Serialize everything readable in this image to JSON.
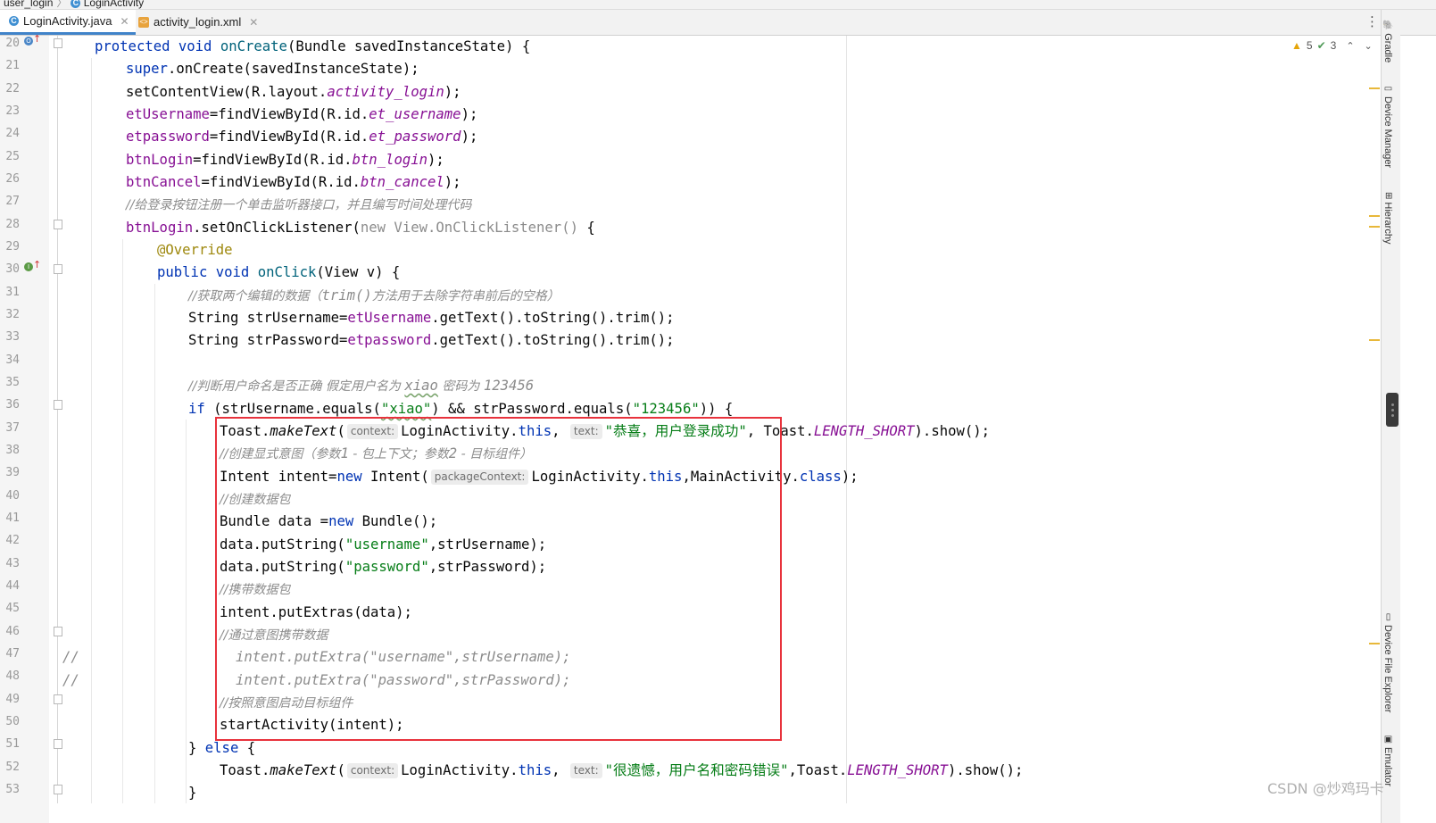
{
  "breadcrumb": {
    "project": "user_login",
    "file": "LoginActivity"
  },
  "tabs": [
    {
      "label": "LoginActivity.java",
      "active": true,
      "icon": "class-c-icon"
    },
    {
      "label": "activity_login.xml",
      "active": false,
      "icon": "xml-file-icon"
    }
  ],
  "inspections": {
    "warnings": "5",
    "typos": "3"
  },
  "line_numbers": [
    "20",
    "21",
    "22",
    "23",
    "24",
    "25",
    "26",
    "27",
    "28",
    "29",
    "30",
    "31",
    "32",
    "33",
    "34",
    "35",
    "36",
    "37",
    "38",
    "39",
    "40",
    "41",
    "42",
    "43",
    "44",
    "45",
    "46",
    "47",
    "48",
    "49",
    "50",
    "51",
    "52",
    "53"
  ],
  "code": {
    "l20": [
      "protected",
      "void",
      "onCreate",
      "(Bundle savedInstanceState) {"
    ],
    "l21": [
      "super",
      ".onCreate(savedInstanceState);"
    ],
    "l22": [
      "setContentView(R.layout.",
      "activity_login",
      ");"
    ],
    "l23": [
      "etUsername",
      "=findViewById(R.id.",
      "et_username",
      ");"
    ],
    "l24": [
      "etpassword",
      "=findViewById(R.id.",
      "et_password",
      ");"
    ],
    "l25": [
      "btnLogin",
      "=findViewById(R.id.",
      "btn_login",
      ");"
    ],
    "l26": [
      "btnCancel",
      "=findViewById(R.id.",
      "btn_cancel",
      ");"
    ],
    "l27": [
      "//给登录按钮注册一个单击监听器接口，并且编写时间处理代码"
    ],
    "l28": [
      "btnLogin",
      ".setOnClickListener(",
      "new View.OnClickListener()",
      " {"
    ],
    "l29": [
      "@Override"
    ],
    "l30": [
      "public",
      "void",
      "onClick",
      "(View v) {"
    ],
    "l31": [
      "//获取两个编辑的数据（",
      "trim()",
      "方法用于去除字符串前后的空格）"
    ],
    "l32": [
      "String strUsername=",
      "etUsername",
      ".getText().toString().trim();"
    ],
    "l33": [
      "String strPassword=",
      "etpassword",
      ".getText().toString().trim();"
    ],
    "l35": [
      "//判断用户命名是否正确 假定用户名为 ",
      "xiao",
      " 密码为 ",
      "123456"
    ],
    "l36": [
      "if",
      " (strUsername.equals(",
      "\"xiao\"",
      ") && strPassword.equals(",
      "\"123456\"",
      ")) {"
    ],
    "l37": [
      "Toast.",
      "makeText",
      "(",
      "context:",
      "LoginActivity.",
      "this",
      ",",
      "text:",
      "\"恭喜，用户登录成功\"",
      ", Toast.",
      "LENGTH_SHORT",
      ").show();"
    ],
    "l38": [
      "//创建显式意图（参数",
      "1",
      " - 包上下文；参数",
      "2",
      " - 目标组件）"
    ],
    "l39": [
      "Intent intent=",
      "new",
      " Intent(",
      "packageContext:",
      "LoginActivity.",
      "this",
      ",MainActivity.",
      "class",
      ");"
    ],
    "l40": [
      "//创建数据包"
    ],
    "l41": [
      "Bundle data =",
      "new",
      " Bundle();"
    ],
    "l42": [
      "data.putString(",
      "\"username\"",
      ",strUsername);"
    ],
    "l43": [
      "data.putString(",
      "\"password\"",
      ",strPassword);"
    ],
    "l44": [
      "//携带数据包"
    ],
    "l45": [
      "intent.putExtras(data);"
    ],
    "l46": [
      "//通过意图携带数据"
    ],
    "l47": [
      "//",
      "intent.putExtra(\"username\",strUsername);"
    ],
    "l48": [
      "//",
      "intent.putExtra(\"password\",strPassword);"
    ],
    "l49": [
      "//按照意图启动目标组件"
    ],
    "l50": [
      "startActivity(intent);"
    ],
    "l51": [
      "} ",
      "else",
      " {"
    ],
    "l52": [
      "Toast.",
      "makeText",
      "(",
      "context:",
      "LoginActivity.",
      "this",
      ",",
      "text:",
      "\"很遗憾，用户名和密码错误\"",
      ",Toast.",
      "LENGTH_SHORT",
      ").show();"
    ],
    "l53": [
      "}"
    ]
  },
  "side_tools": [
    "Gradle",
    "Device Manager",
    "Hierarchy",
    "Device File Explorer",
    "Emulator"
  ],
  "watermark": "CSDN @炒鸡玛卡",
  "colors": {
    "keyword": "#0033b3",
    "field": "#871094",
    "string": "#067d17",
    "comment": "#8c8c8c",
    "annotation": "#9e880d",
    "method_decl": "#00627a",
    "highlight_box": "#e8323c",
    "warning": "#e5a50a"
  }
}
